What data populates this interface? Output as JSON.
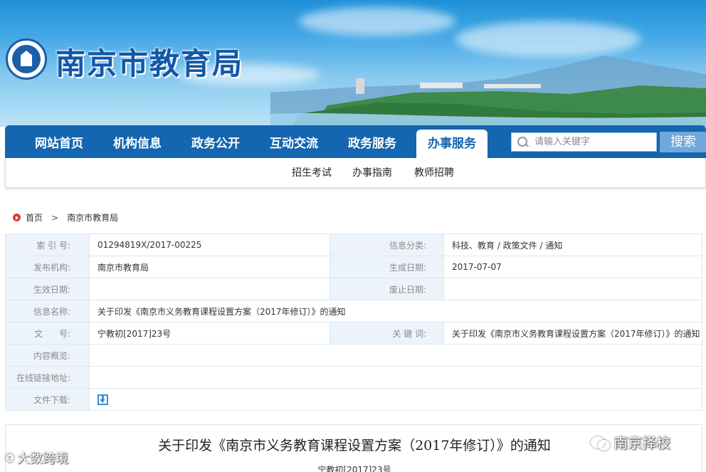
{
  "header": {
    "site_title": "南京市教育局",
    "logo_icon": "city-seal-logo"
  },
  "nav": {
    "items": [
      {
        "label": "网站首页",
        "active": false
      },
      {
        "label": "机构信息",
        "active": false
      },
      {
        "label": "政务公开",
        "active": false
      },
      {
        "label": "互动交流",
        "active": false
      },
      {
        "label": "政务服务",
        "active": false
      },
      {
        "label": "办事服务",
        "active": true
      }
    ],
    "search_placeholder": "请输入关键字",
    "search_button": "搜索",
    "primary_color": "#1466b0"
  },
  "subnav": {
    "items": [
      "招生考试",
      "办事指南",
      "教师招聘"
    ]
  },
  "breadcrumb": {
    "items": [
      "首页",
      "南京市教育局"
    ],
    "separator": ">"
  },
  "info": {
    "index_label": "索 引 号:",
    "index_value": "01294819X/2017-00225",
    "category_label": "信息分类:",
    "category_value": "科技、教育 / 政策文件 / 通知",
    "publisher_label": "发布机构:",
    "publisher_value": "南京市教育局",
    "created_label": "生成日期:",
    "created_value": "2017-07-07",
    "effective_label": "生效日期:",
    "effective_value": "",
    "expired_label": "废止日期:",
    "expired_value": "",
    "name_label": "信息名称:",
    "name_value": "关于印发《南京市义务教育课程设置方案（2017年修订）》的通知",
    "docno_label": "文      号:",
    "docno_value": "宁教初[2017]23号",
    "keywords_label": "关 键 词:",
    "keywords_value": "关于印发《南京市义务教育课程设置方案（2017年修订）》的通知",
    "summary_label": "内容概览:",
    "summary_value": "",
    "link_label": "在线链接地址:",
    "link_value": "",
    "download_label": "文件下载:",
    "download_icon": "download-icon"
  },
  "article": {
    "title": "关于印发《南京市义务教育课程设置方案（2017年修订）》的通知",
    "doc_number": "宁教初[2017]23号"
  },
  "watermarks": {
    "left": "大数跨境",
    "right": "南京择校"
  }
}
